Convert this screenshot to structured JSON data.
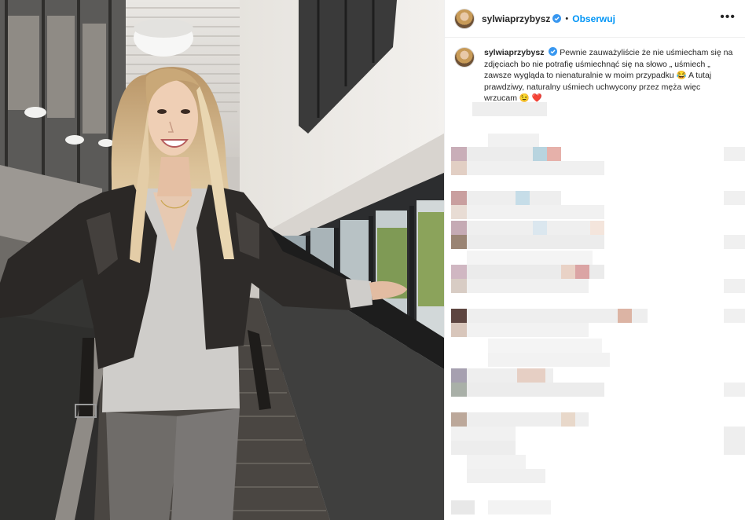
{
  "post": {
    "username": "sylwiaprzybysz",
    "follow_label": "Obserwuj",
    "dot": "•",
    "more_label": "•••",
    "caption": "Pewnie zauważyliście że nie uśmiecham się na zdjęciach bo nie potrafię uśmiechnąć się na słowo „ uśmiech „ zawsze wygląda to nienaturalnie w moim przypadku 😂 A tutaj prawdziwy, naturalny uśmiech uchwycony przez męża więc wrzucam 😉 ❤️"
  },
  "colors": {
    "follow_blue": "#0095f6",
    "verified_blue": "#3897f0",
    "text": "#262626",
    "border": "#efefef"
  },
  "icons": [
    "verified-badge-icon",
    "more-options-icon",
    "laughing-emoji-icon",
    "winking-emoji-icon",
    "heart-emoji-icon"
  ]
}
